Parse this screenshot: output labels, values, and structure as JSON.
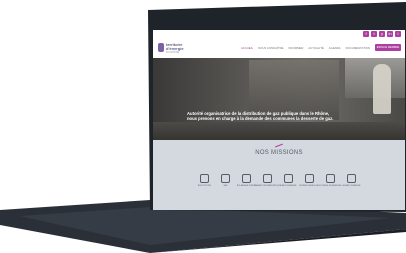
{
  "site": {
    "logo_line1": "territoire",
    "logo_line2": "d'énergie",
    "logo_line3": "DU RHÔNE"
  },
  "social": [
    "f",
    "t",
    "y",
    "in",
    "i"
  ],
  "nav": {
    "items": [
      "ACCUEIL",
      "NOUS CONNAÎTRE",
      "INFORMER",
      "ACTUALITÉ",
      "AGENDA",
      "DOCUMENTATION",
      "CONTACT"
    ],
    "cta": "ESPACE MEMBRE"
  },
  "hero": {
    "text": "Autorité organisatrice de la distribution de gaz publique dans le Rhône, nous prenons en charge à la demande des communes la desserte de gaz."
  },
  "missions": {
    "title": "NOS MISSIONS",
    "items": [
      {
        "label": "ÉLECTRICITÉ",
        "icon": "electricity-icon"
      },
      {
        "label": "GAZ",
        "icon": "gas-icon"
      },
      {
        "label": "ÉCLAIRAGE PUBLIC",
        "icon": "lighting-icon"
      },
      {
        "label": "TRANSITION ÉNERGÉTIQUE",
        "icon": "energy-transition-icon"
      },
      {
        "label": "CARTOGRAPHIE",
        "icon": "map-icon"
      },
      {
        "label": "BORNES VÉHICULES",
        "icon": "charging-icon"
      },
      {
        "label": "CONSEIL EN ÉNERGIE",
        "icon": "advice-icon"
      },
      {
        "label": "ACHAT D'ÉNERGIE",
        "icon": "purchase-icon"
      }
    ]
  },
  "colors": {
    "accent": "#ad3fa0",
    "missions_bg": "#d4d9df",
    "laptop_body": "#2b3038"
  }
}
